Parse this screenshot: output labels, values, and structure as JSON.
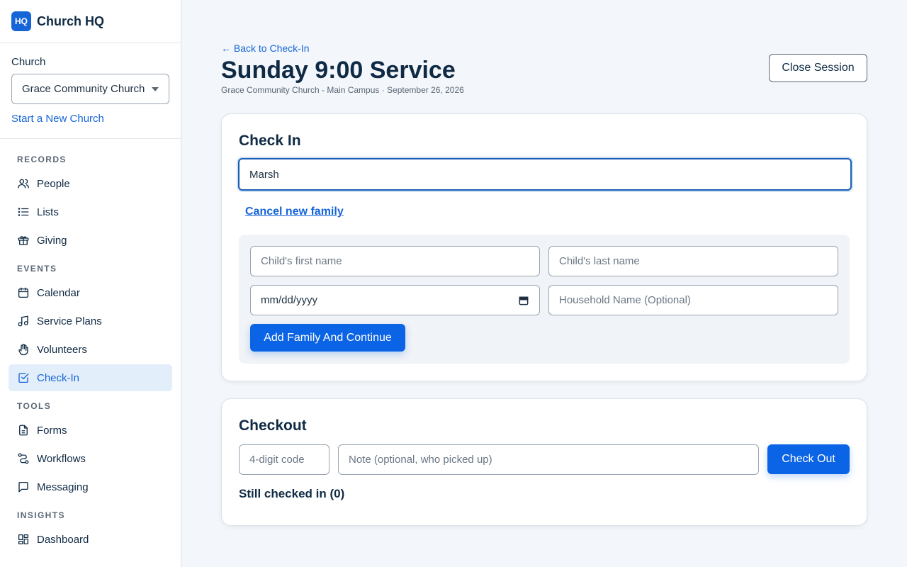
{
  "brand": {
    "logo": "HQ",
    "name": "Church HQ"
  },
  "church": {
    "label": "Church",
    "selected": "Grace Community Church - Main Campus",
    "new_link": "Start a New Church"
  },
  "nav": {
    "records": {
      "heading": "RECORDS",
      "items": [
        "People",
        "Lists",
        "Giving"
      ]
    },
    "events": {
      "heading": "EVENTS",
      "items": [
        "Calendar",
        "Service Plans",
        "Volunteers",
        "Check-In"
      ]
    },
    "tools": {
      "heading": "TOOLS",
      "items": [
        "Forms",
        "Workflows",
        "Messaging"
      ]
    },
    "insights": {
      "heading": "INSIGHTS",
      "items": [
        "Dashboard"
      ]
    },
    "active": "Check-In"
  },
  "header": {
    "back": "← Back to Check-In",
    "title": "Sunday 9:00 Service",
    "subtitle": "Grace Community Church - Main Campus · September 26, 2026",
    "close": "Close Session"
  },
  "checkin": {
    "title": "Check In",
    "search_value": "Marsh",
    "cancel": "Cancel new family",
    "first_placeholder": "Child's first name",
    "last_placeholder": "Child's last name",
    "dob_placeholder": "mm/dd/yyyy",
    "household_placeholder": "Household Name (Optional)",
    "add_button": "Add Family And Continue"
  },
  "checkout": {
    "title": "Checkout",
    "code_placeholder": "4-digit code",
    "note_placeholder": "Note (optional, who picked up)",
    "button": "Check Out",
    "still_in": "Still checked in (0)"
  },
  "colors": {
    "accent": "#1565d8",
    "button": "#0b63e5",
    "text": "#0f2a44"
  }
}
